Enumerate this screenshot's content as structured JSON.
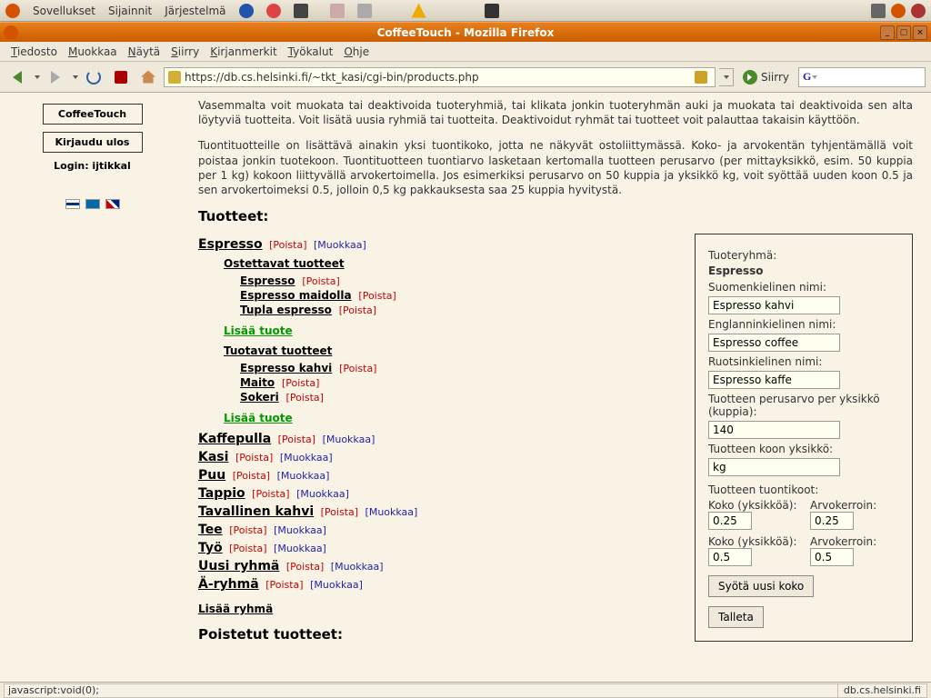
{
  "gnome": {
    "apps": "Sovellukset",
    "places": "Sijainnit",
    "system": "Järjestelmä"
  },
  "window": {
    "title": "CoffeeTouch - Mozilla Firefox"
  },
  "menu": {
    "file": "Tiedosto",
    "edit": "Muokkaa",
    "view": "Näytä",
    "go": "Siirry",
    "bookmarks": "Kirjanmerkit",
    "tools": "Työkalut",
    "help": "Ohje"
  },
  "url": "https://db.cs.helsinki.fi/~tkt_kasi/cgi-bin/products.php",
  "go_label": "Siirry",
  "search_placeholder": "G",
  "sidebar": {
    "app_name": "CoffeeTouch",
    "logout": "Kirjaudu ulos",
    "login_label": "Login: ijtikkal"
  },
  "intro1": "Vasemmalta voit muokata tai deaktivoida tuoteryhmiä, tai klikata jonkin tuoteryhmän auki ja muokata tai deaktivoida sen alta löytyviä tuotteita. Voit lisätä uusia ryhmiä tai tuotteita. Deaktivoidut ryhmät tai tuotteet voit palauttaa takaisin käyttöön.",
  "intro2": "Tuontituotteille on lisättävä ainakin yksi tuontikoko, jotta ne näkyvät ostoliittymässä. Koko- ja arvokentän tyhjentämällä voit poistaa jonkin tuotekoon. Tuontituotteen tuontiarvo lasketaan kertomalla tuotteen perusarvo (per mittayksikkö, esim. 50 kuppia per 1 kg) kokoon liittyvällä arvokertoimella. Jos esimerkiksi perusarvo on 50 kuppia ja yksikkö kg, voit syöttää uuden koon 0.5 ja sen arvokertoimeksi 0.5, jolloin 0,5 kg pakkauksesta saa 25 kuppia hyvitystä.",
  "sec_products": "Tuotteet:",
  "sec_deleted": "Poistetut tuotteet:",
  "labels": {
    "poista": "[Poista]",
    "muokkaa": "[Muokkaa]",
    "lisaa_tuote": "Lisää tuote",
    "lisaa_ryhma": "Lisää ryhmä",
    "ostettavat": "Ostettavat tuotteet",
    "tuotavat": "Tuotavat tuotteet"
  },
  "expanded_group": "Espresso",
  "ostettavat": [
    "Espresso",
    "Espresso maidolla",
    "Tupla espresso"
  ],
  "tuotavat": [
    "Espresso kahvi",
    "Maito",
    "Sokeri"
  ],
  "groups": [
    "Kaffepulla",
    "Kasi",
    "Puu",
    "Tappio",
    "Tavallinen kahvi",
    "Tee",
    "Työ",
    "Uusi ryhmä",
    "Ä-ryhmä"
  ],
  "form": {
    "group_label": "Tuoteryhmä:",
    "group_value": "Espresso",
    "fi_label": "Suomenkielinen nimi:",
    "fi_value": "Espresso kahvi",
    "en_label": "Englanninkielinen nimi:",
    "en_value": "Espresso coffee",
    "sv_label": "Ruotsinkielinen nimi:",
    "sv_value": "Espresso kaffe",
    "base_label": "Tuotteen perusarvo per yksikkö (kuppia):",
    "base_value": "140",
    "unit_label": "Tuotteen koon yksikkö:",
    "unit_value": "kg",
    "sizes_label": "Tuotteen tuontikoot:",
    "size_col1": "Koko (yksikköä):",
    "size_col2": "Arvokerroin:",
    "size1a": "0.25",
    "size1b": "0.25",
    "size2a": "0.5",
    "size2b": "0.5",
    "add_size": "Syötä uusi koko",
    "save": "Talleta"
  },
  "status_left": "javascript:void(0);",
  "status_right": "db.cs.helsinki.fi"
}
